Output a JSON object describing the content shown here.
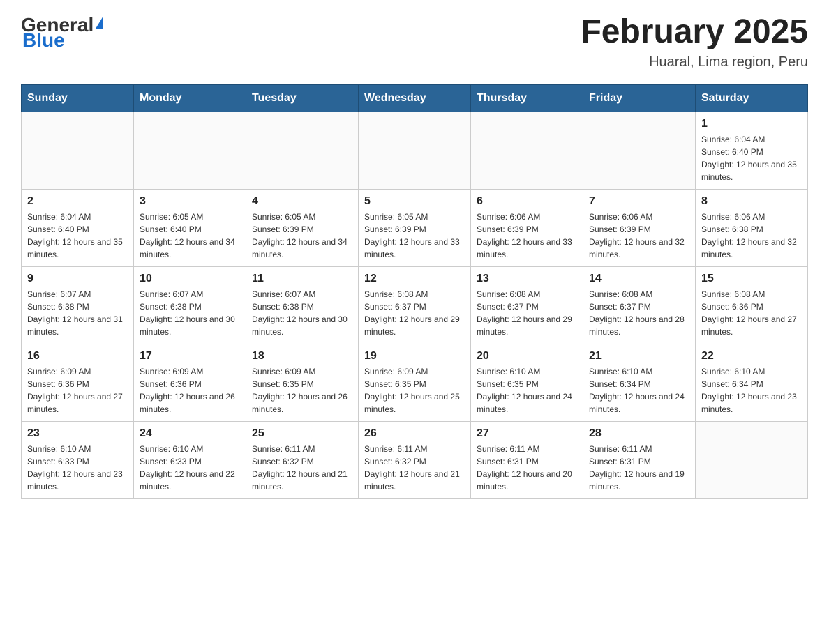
{
  "logo": {
    "general": "General",
    "blue": "Blue"
  },
  "title": "February 2025",
  "subtitle": "Huaral, Lima region, Peru",
  "days_of_week": [
    "Sunday",
    "Monday",
    "Tuesday",
    "Wednesday",
    "Thursday",
    "Friday",
    "Saturday"
  ],
  "weeks": [
    [
      {
        "day": "",
        "info": ""
      },
      {
        "day": "",
        "info": ""
      },
      {
        "day": "",
        "info": ""
      },
      {
        "day": "",
        "info": ""
      },
      {
        "day": "",
        "info": ""
      },
      {
        "day": "",
        "info": ""
      },
      {
        "day": "1",
        "info": "Sunrise: 6:04 AM\nSunset: 6:40 PM\nDaylight: 12 hours and 35 minutes."
      }
    ],
    [
      {
        "day": "2",
        "info": "Sunrise: 6:04 AM\nSunset: 6:40 PM\nDaylight: 12 hours and 35 minutes."
      },
      {
        "day": "3",
        "info": "Sunrise: 6:05 AM\nSunset: 6:40 PM\nDaylight: 12 hours and 34 minutes."
      },
      {
        "day": "4",
        "info": "Sunrise: 6:05 AM\nSunset: 6:39 PM\nDaylight: 12 hours and 34 minutes."
      },
      {
        "day": "5",
        "info": "Sunrise: 6:05 AM\nSunset: 6:39 PM\nDaylight: 12 hours and 33 minutes."
      },
      {
        "day": "6",
        "info": "Sunrise: 6:06 AM\nSunset: 6:39 PM\nDaylight: 12 hours and 33 minutes."
      },
      {
        "day": "7",
        "info": "Sunrise: 6:06 AM\nSunset: 6:39 PM\nDaylight: 12 hours and 32 minutes."
      },
      {
        "day": "8",
        "info": "Sunrise: 6:06 AM\nSunset: 6:38 PM\nDaylight: 12 hours and 32 minutes."
      }
    ],
    [
      {
        "day": "9",
        "info": "Sunrise: 6:07 AM\nSunset: 6:38 PM\nDaylight: 12 hours and 31 minutes."
      },
      {
        "day": "10",
        "info": "Sunrise: 6:07 AM\nSunset: 6:38 PM\nDaylight: 12 hours and 30 minutes."
      },
      {
        "day": "11",
        "info": "Sunrise: 6:07 AM\nSunset: 6:38 PM\nDaylight: 12 hours and 30 minutes."
      },
      {
        "day": "12",
        "info": "Sunrise: 6:08 AM\nSunset: 6:37 PM\nDaylight: 12 hours and 29 minutes."
      },
      {
        "day": "13",
        "info": "Sunrise: 6:08 AM\nSunset: 6:37 PM\nDaylight: 12 hours and 29 minutes."
      },
      {
        "day": "14",
        "info": "Sunrise: 6:08 AM\nSunset: 6:37 PM\nDaylight: 12 hours and 28 minutes."
      },
      {
        "day": "15",
        "info": "Sunrise: 6:08 AM\nSunset: 6:36 PM\nDaylight: 12 hours and 27 minutes."
      }
    ],
    [
      {
        "day": "16",
        "info": "Sunrise: 6:09 AM\nSunset: 6:36 PM\nDaylight: 12 hours and 27 minutes."
      },
      {
        "day": "17",
        "info": "Sunrise: 6:09 AM\nSunset: 6:36 PM\nDaylight: 12 hours and 26 minutes."
      },
      {
        "day": "18",
        "info": "Sunrise: 6:09 AM\nSunset: 6:35 PM\nDaylight: 12 hours and 26 minutes."
      },
      {
        "day": "19",
        "info": "Sunrise: 6:09 AM\nSunset: 6:35 PM\nDaylight: 12 hours and 25 minutes."
      },
      {
        "day": "20",
        "info": "Sunrise: 6:10 AM\nSunset: 6:35 PM\nDaylight: 12 hours and 24 minutes."
      },
      {
        "day": "21",
        "info": "Sunrise: 6:10 AM\nSunset: 6:34 PM\nDaylight: 12 hours and 24 minutes."
      },
      {
        "day": "22",
        "info": "Sunrise: 6:10 AM\nSunset: 6:34 PM\nDaylight: 12 hours and 23 minutes."
      }
    ],
    [
      {
        "day": "23",
        "info": "Sunrise: 6:10 AM\nSunset: 6:33 PM\nDaylight: 12 hours and 23 minutes."
      },
      {
        "day": "24",
        "info": "Sunrise: 6:10 AM\nSunset: 6:33 PM\nDaylight: 12 hours and 22 minutes."
      },
      {
        "day": "25",
        "info": "Sunrise: 6:11 AM\nSunset: 6:32 PM\nDaylight: 12 hours and 21 minutes."
      },
      {
        "day": "26",
        "info": "Sunrise: 6:11 AM\nSunset: 6:32 PM\nDaylight: 12 hours and 21 minutes."
      },
      {
        "day": "27",
        "info": "Sunrise: 6:11 AM\nSunset: 6:31 PM\nDaylight: 12 hours and 20 minutes."
      },
      {
        "day": "28",
        "info": "Sunrise: 6:11 AM\nSunset: 6:31 PM\nDaylight: 12 hours and 19 minutes."
      },
      {
        "day": "",
        "info": ""
      }
    ]
  ]
}
